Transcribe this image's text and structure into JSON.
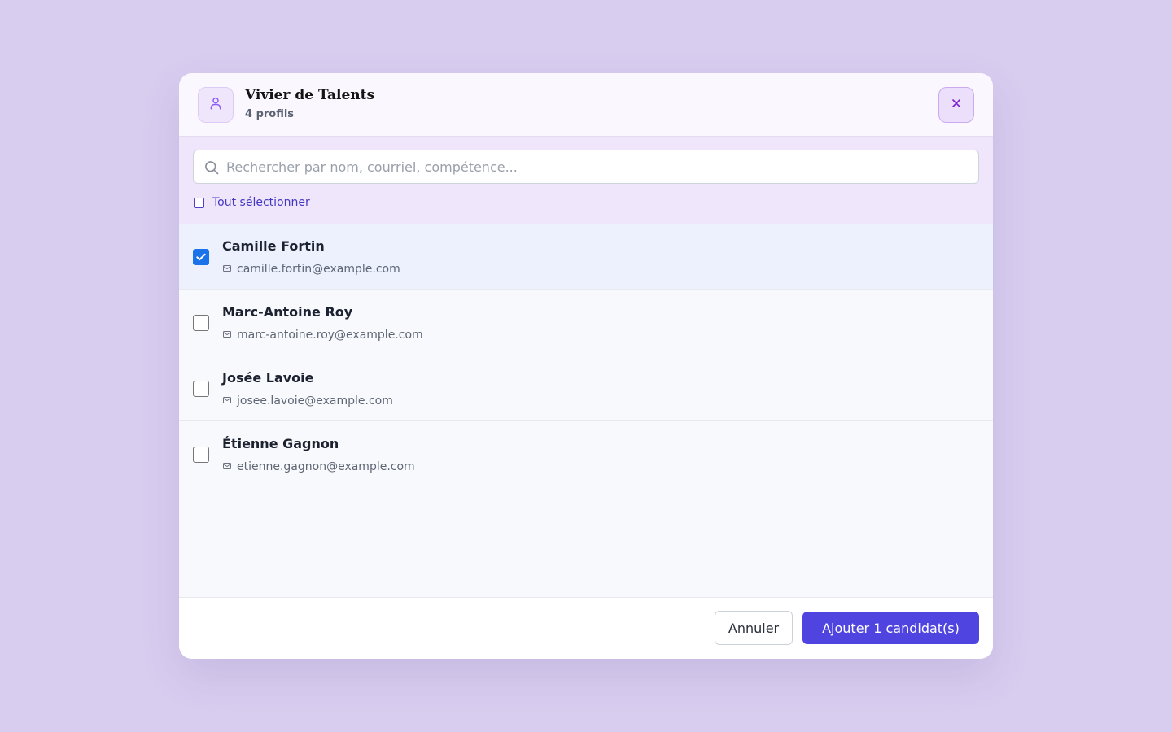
{
  "header": {
    "title": "Vivier de Talents",
    "subtitle": "4 profils",
    "avatar_icon": "user-icon",
    "close_icon": "close-icon"
  },
  "search": {
    "placeholder": "Rechercher par nom, courriel, compétence...",
    "value": "",
    "icon": "search-icon"
  },
  "select_all": {
    "label": "Tout sélectionner",
    "checked": false
  },
  "candidates": [
    {
      "name": "Camille Fortin",
      "email": "camille.fortin@example.com",
      "selected": true
    },
    {
      "name": "Marc-Antoine Roy",
      "email": "marc-antoine.roy@example.com",
      "selected": false
    },
    {
      "name": "Josée Lavoie",
      "email": "josee.lavoie@example.com",
      "selected": false
    },
    {
      "name": "Étienne Gagnon",
      "email": "etienne.gagnon@example.com",
      "selected": false
    }
  ],
  "footer": {
    "cancel_label": "Annuler",
    "add_label": "Ajouter 1 candidat(s)"
  },
  "colors": {
    "page_background": "#d8cdef",
    "accent": "#4f44e0",
    "accent_light": "#efe6fc",
    "close_icon": "#7e22ce",
    "checkbox_checked": "#1a73e8",
    "selected_row": "#ecf1fd"
  }
}
